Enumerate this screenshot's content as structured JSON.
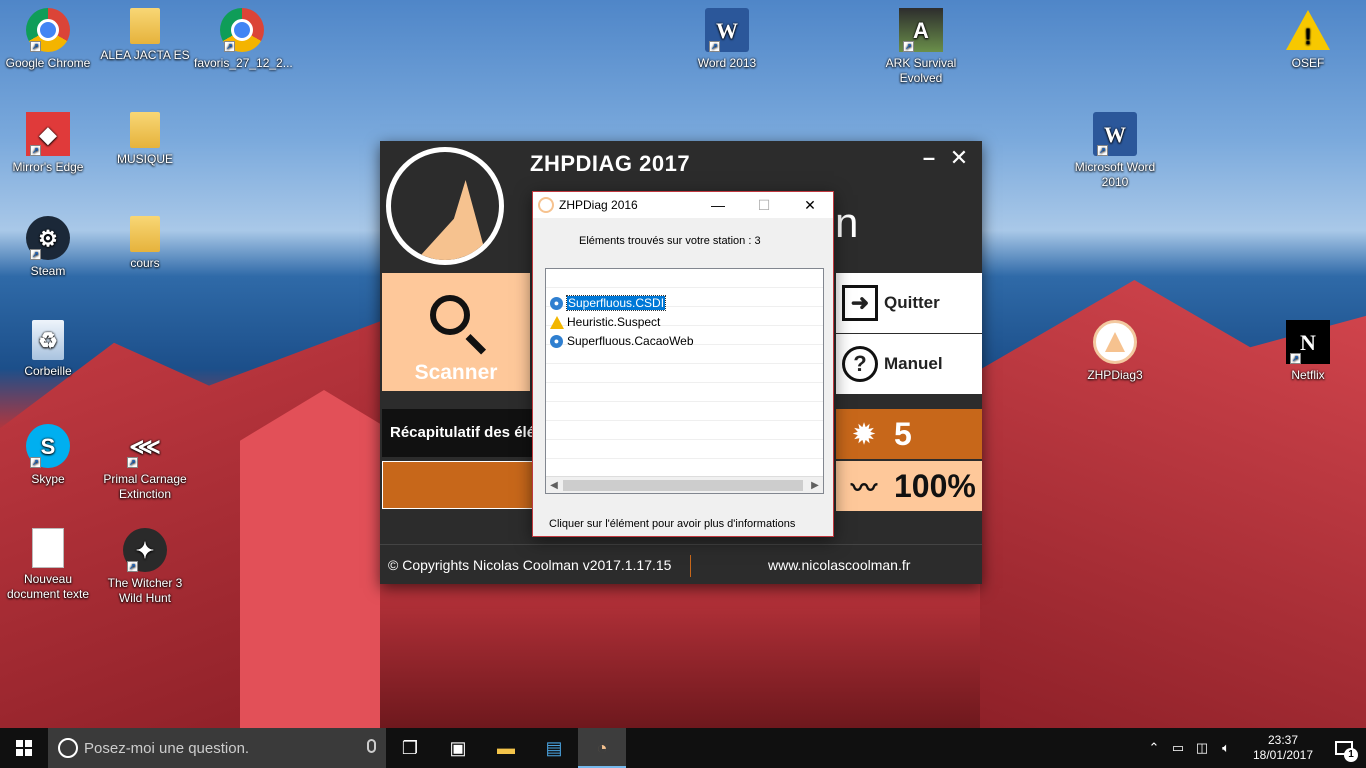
{
  "desktop": {
    "icons": [
      {
        "label": "Google Chrome",
        "glyph": ""
      },
      {
        "label": "ALEA JACTA ES",
        "glyph": ""
      },
      {
        "label": "favoris_27_12_2...",
        "glyph": ""
      },
      {
        "label": "Word 2013",
        "glyph": "W"
      },
      {
        "label": "ARK Survival Evolved",
        "glyph": "A"
      },
      {
        "label": "OSEF",
        "glyph": "!"
      },
      {
        "label": "Mirror's Edge",
        "glyph": "◆"
      },
      {
        "label": "MUSIQUE",
        "glyph": ""
      },
      {
        "label": "Microsoft Word 2010",
        "glyph": "W"
      },
      {
        "label": "Steam",
        "glyph": "⚙"
      },
      {
        "label": "cours",
        "glyph": ""
      },
      {
        "label": "Corbeille",
        "glyph": "♻"
      },
      {
        "label": "ZHPDiag3",
        "glyph": ""
      },
      {
        "label": "Netflix",
        "glyph": "N"
      },
      {
        "label": "Skype",
        "glyph": "S"
      },
      {
        "label": "Primal Carnage Extinction",
        "glyph": "⋘"
      },
      {
        "label": "Nouveau document texte",
        "glyph": ""
      },
      {
        "label": "The Witcher 3 Wild Hunt",
        "glyph": "✦"
      }
    ]
  },
  "zhp": {
    "title": "ZHPDIAG 2017",
    "min_label": "–",
    "close_label": "✕",
    "brand_fragment": "n",
    "scan_label": "Scanner",
    "quit_label": "Quitter",
    "manual_label": "Manuel",
    "recap_label": "Récapitulatif des élém",
    "bug_count": "5",
    "progress_label": "100%",
    "copyright": "© Copyrights Nicolas Coolman v2017.1.17.15",
    "website": "www.nicolascoolman.fr"
  },
  "dialog": {
    "title": "ZHPDiag 2016",
    "min_label": "—",
    "max_label": "☐",
    "close_label": "✕",
    "found_text": "Eléments trouvés sur votre station : 3",
    "items": [
      {
        "label": "Superfluous.CSDI",
        "icon": "info"
      },
      {
        "label": "Heuristic.Suspect",
        "icon": "warning"
      },
      {
        "label": "Superfluous.CacaoWeb",
        "icon": "info"
      }
    ],
    "hint": "Cliquer sur l'élément pour avoir plus d'informations"
  },
  "taskbar": {
    "search_placeholder": "Posez-moi une question.",
    "time": "23:37",
    "date": "18/01/2017",
    "notif_count": "1"
  }
}
